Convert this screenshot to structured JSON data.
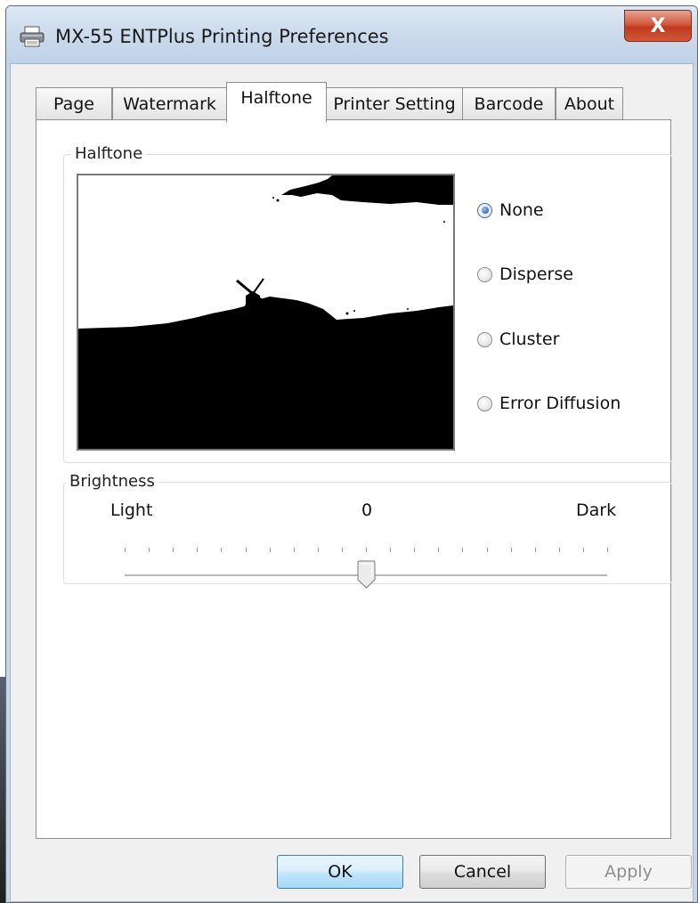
{
  "window": {
    "title": "MX-55 ENTPlus Printing Preferences",
    "icon": "printer-icon",
    "close_glyph": "X"
  },
  "tabs": [
    {
      "label": "Page",
      "active": false
    },
    {
      "label": "Watermark",
      "active": false
    },
    {
      "label": "Halftone",
      "active": true
    },
    {
      "label": "Printer Setting",
      "active": false
    },
    {
      "label": "Barcode",
      "active": false
    },
    {
      "label": "About",
      "active": false
    }
  ],
  "halftone": {
    "group_label": "Halftone",
    "preview_image": "windmill-landscape-halftone-preview",
    "options": [
      {
        "label": "None",
        "checked": true
      },
      {
        "label": "Disperse",
        "checked": false
      },
      {
        "label": "Cluster",
        "checked": false
      },
      {
        "label": "Error Diffusion",
        "checked": false
      }
    ]
  },
  "brightness": {
    "group_label": "Brightness",
    "min_label": "Light",
    "value_label": "0",
    "max_label": "Dark",
    "value": 0,
    "min": -10,
    "max": 10
  },
  "buttons": {
    "ok": "OK",
    "cancel": "Cancel",
    "apply": "Apply"
  },
  "colors": {
    "title_bar": "#c7d8ea",
    "close_button": "#c8442a",
    "default_button_border": "#3c7fb1",
    "radio_selected": "#1a4f9c"
  }
}
